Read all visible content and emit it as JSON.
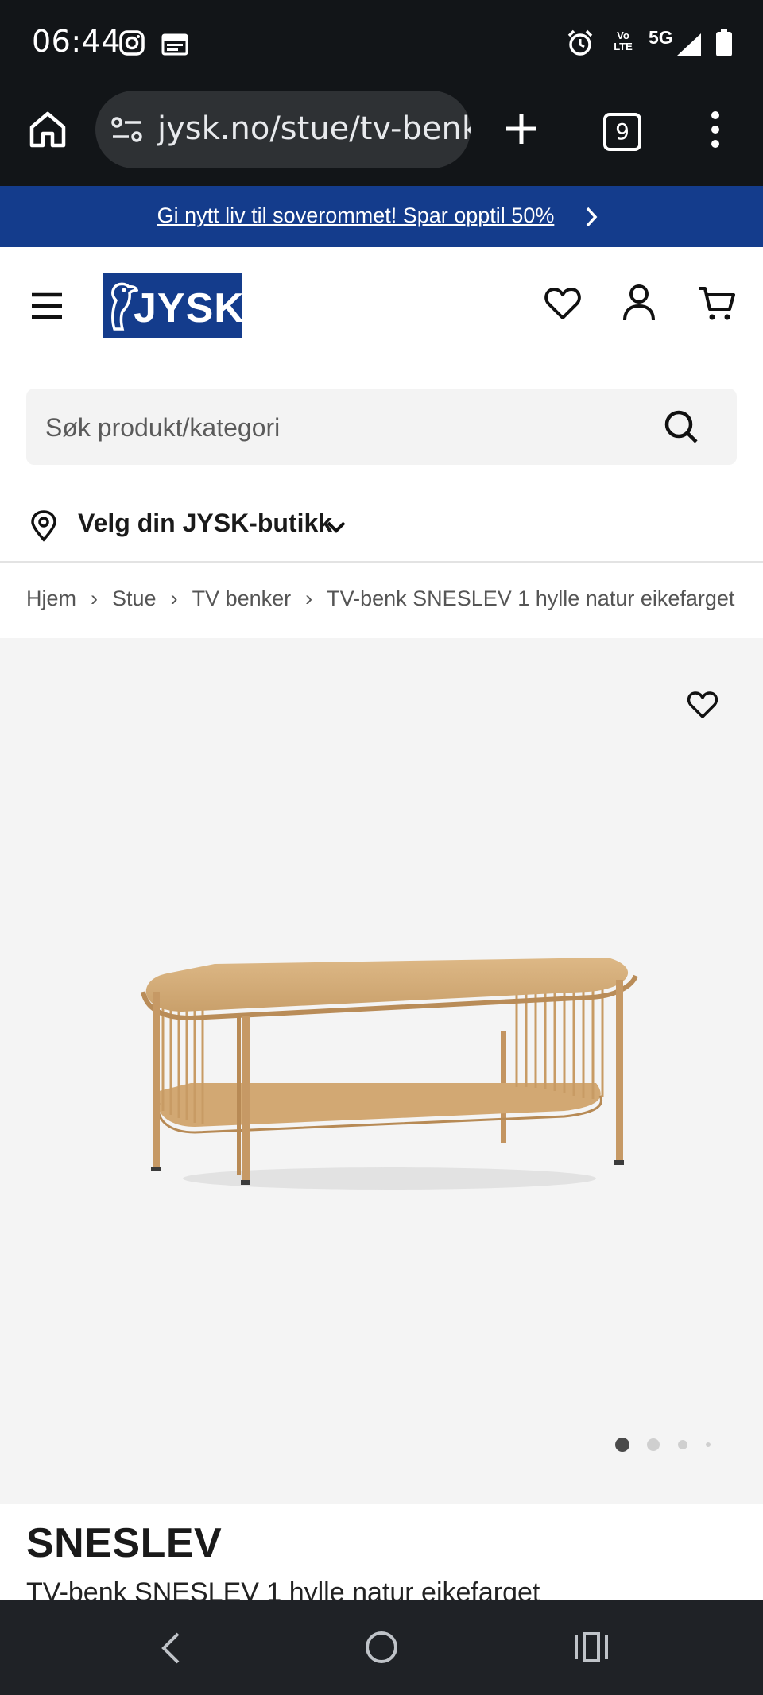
{
  "status_bar": {
    "time": "06:44",
    "network": "5G",
    "volte": "Vo LTE"
  },
  "browser": {
    "url": "jysk.no/stue/tv-benker",
    "tab_count": "9"
  },
  "promo": {
    "text": "Gi nytt liv til soverommet! Spar opptil 50%"
  },
  "header": {
    "logo_text": "JYSK",
    "brand_color": "#143c8c"
  },
  "search": {
    "placeholder": "Søk produkt/kategori"
  },
  "store": {
    "label": "Velg din JYSK-butikk"
  },
  "breadcrumb": {
    "items": [
      "Hjem",
      "Stue",
      "TV benker",
      "TV-benk SNESLEV 1 hylle natur eikefarget"
    ]
  },
  "gallery": {
    "image_count": 4,
    "active_index": 0
  },
  "product": {
    "brand": "SNESLEV",
    "name": "TV-benk SNESLEV 1 hylle natur eikefarget"
  }
}
